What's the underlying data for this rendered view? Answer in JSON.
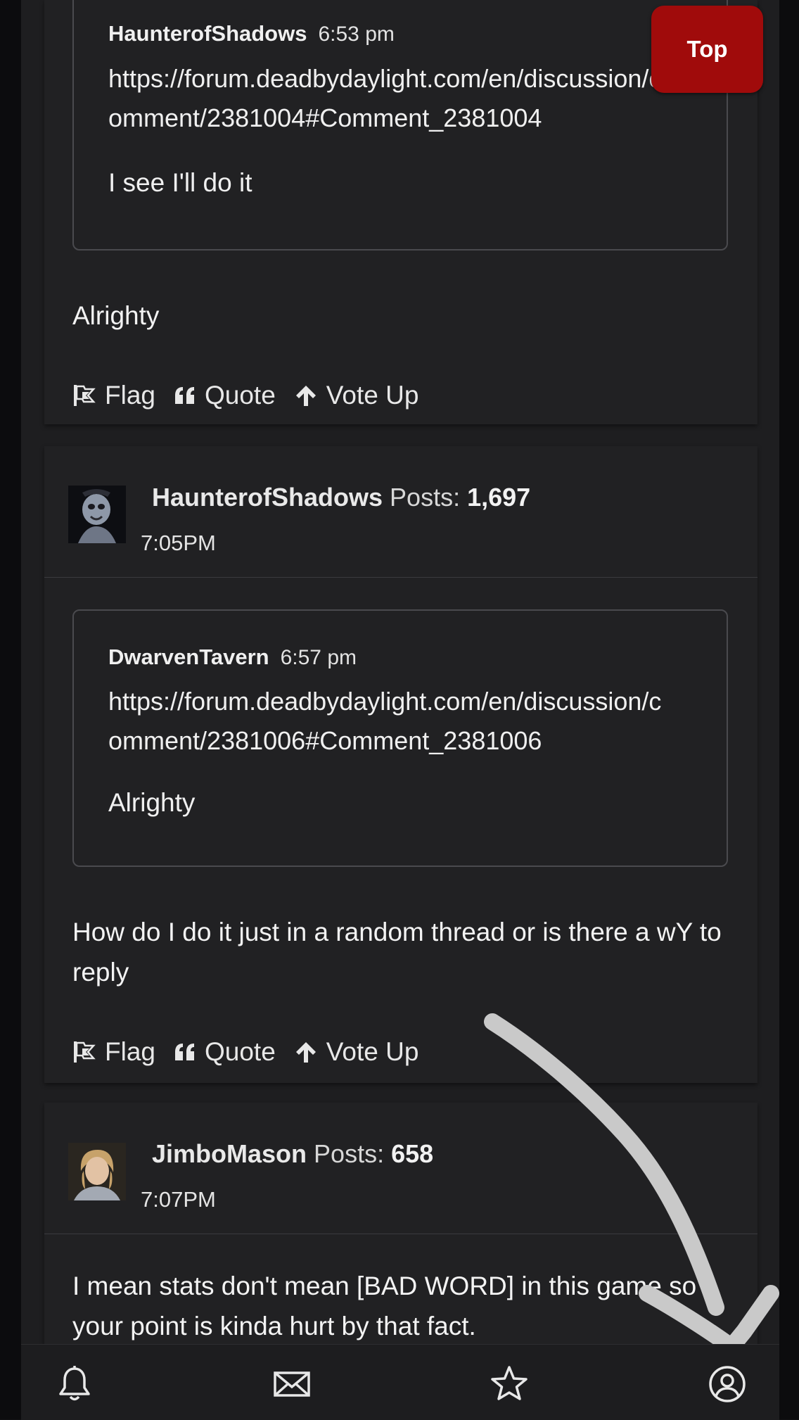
{
  "top_button": {
    "label": "Top"
  },
  "post1": {
    "quote": {
      "author": "HaunterofShadows",
      "time": "6:53 pm",
      "link": "https://forum.deadbydaylight.com/en/discussion/comment/2381004#Comment_2381004",
      "text": "I see I'll do it"
    },
    "body": "Alrighty",
    "actions": {
      "flag": "Flag",
      "quote": "Quote",
      "vote_up": "Vote Up"
    }
  },
  "post2": {
    "author": "HaunterofShadows",
    "posts_label": "Posts:",
    "posts_count": "1,697",
    "time": "7:05PM",
    "quote": {
      "author": "DwarvenTavern",
      "time": "6:57 pm",
      "link": "https://forum.deadbydaylight.com/en/discussion/comment/2381006#Comment_2381006",
      "text": "Alrighty"
    },
    "body": "How do I do it just in a random thread or is there a wY to reply",
    "actions": {
      "flag": "Flag",
      "quote": "Quote",
      "vote_up": "Vote Up"
    }
  },
  "post3": {
    "author": "JimboMason",
    "posts_label": "Posts:",
    "posts_count": "658",
    "time": "7:07PM",
    "body": "I mean stats don't mean [BAD WORD] in this game so your point is kinda hurt by that fact."
  },
  "bottom_nav": {
    "icons": [
      "bell-icon",
      "envelope-icon",
      "star-icon",
      "user-circle-icon"
    ]
  },
  "colors": {
    "accent_red": "#a00b0b",
    "card_bg": "#212123",
    "page_bg": "#2a2b2f",
    "text": "#f0f0f0"
  }
}
